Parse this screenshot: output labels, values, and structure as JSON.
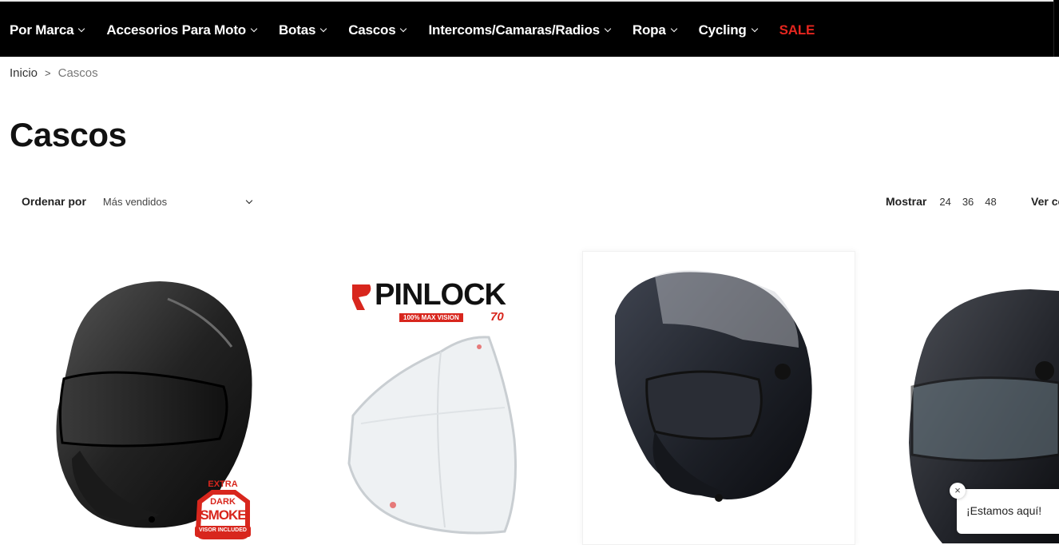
{
  "nav": {
    "items": [
      {
        "label": "Por Marca",
        "has_dropdown": true
      },
      {
        "label": "Accesorios Para Moto",
        "has_dropdown": true
      },
      {
        "label": "Botas",
        "has_dropdown": true
      },
      {
        "label": "Cascos",
        "has_dropdown": true
      },
      {
        "label": "Intercoms/Camaras/Radios",
        "has_dropdown": true
      },
      {
        "label": "Ropa",
        "has_dropdown": true
      },
      {
        "label": "Cycling",
        "has_dropdown": true
      }
    ],
    "sale_label": "SALE",
    "sale_color": "#e5261f"
  },
  "breadcrumb": {
    "home": "Inicio",
    "separator": ">",
    "current": "Cascos"
  },
  "page_title": "Cascos",
  "sort": {
    "label": "Ordenar por",
    "selected": "Más vendidos"
  },
  "show": {
    "label": "Mostrar",
    "options": [
      "24",
      "36",
      "48"
    ]
  },
  "view": {
    "label": "Ver como"
  },
  "products": {
    "p1": {
      "badge_top": "EXTRA",
      "badge_line1": "DARK",
      "badge_line2": "SMOKE",
      "badge_bottom": "VISOR INCLUDED"
    },
    "p2": {
      "brand": "PINLOCK",
      "tagline": "100% MAX VISION",
      "number": "70"
    }
  },
  "chat": {
    "text": "¡Estamos aquí!",
    "close_icon": "×"
  }
}
